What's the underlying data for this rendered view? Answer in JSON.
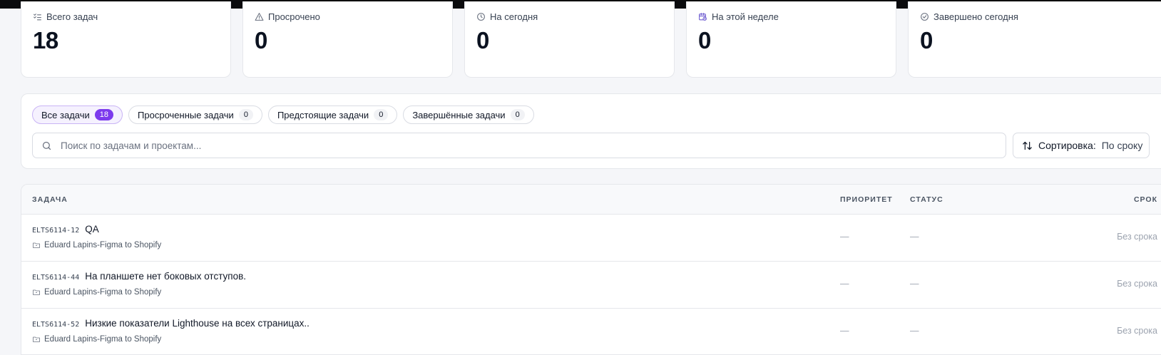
{
  "stats": [
    {
      "label": "Всего задач",
      "value": "18",
      "icon": "checklist-icon"
    },
    {
      "label": "Просрочено",
      "value": "0",
      "icon": "warning-icon"
    },
    {
      "label": "На сегодня",
      "value": "0",
      "icon": "clock-icon"
    },
    {
      "label": "На этой неделе",
      "value": "0",
      "icon": "calendar-clock-icon"
    },
    {
      "label": "Завершено сегодня",
      "value": "0",
      "icon": "check-circle-icon"
    }
  ],
  "filters": {
    "tabs": [
      {
        "label": "Все задачи",
        "count": "18",
        "active": true
      },
      {
        "label": "Просроченные задачи",
        "count": "0"
      },
      {
        "label": "Предстоящие задачи",
        "count": "0"
      },
      {
        "label": "Завершённые задачи",
        "count": "0"
      }
    ],
    "search_placeholder": "Поиск по задачам и проектам...",
    "search_value": "",
    "sort_label": "Сортировка:",
    "sort_value": "По сроку"
  },
  "table": {
    "columns": {
      "task": "ЗАДАЧА",
      "priority": "ПРИОРИТЕТ",
      "status": "СТАТУС",
      "due": "СРОК"
    },
    "rows": [
      {
        "id": "ELTS6114-12",
        "title": "QA",
        "project": "Eduard Lapins-Figma to Shopify",
        "priority": "—",
        "status": "—",
        "due": "Без срока"
      },
      {
        "id": "ELTS6114-44",
        "title": "На планшете нет боковых отступов.",
        "project": "Eduard Lapins-Figma to Shopify",
        "priority": "—",
        "status": "—",
        "due": "Без срока"
      },
      {
        "id": "ELTS6114-52",
        "title": "Низкие показатели Lighthouse на всех страницах..",
        "project": "Eduard Lapins-Figma to Shopify",
        "priority": "—",
        "status": "—",
        "due": "Без срока"
      }
    ]
  },
  "colors": {
    "accent": "#7c3aed",
    "calendar_icon": "#6d5bd0"
  }
}
